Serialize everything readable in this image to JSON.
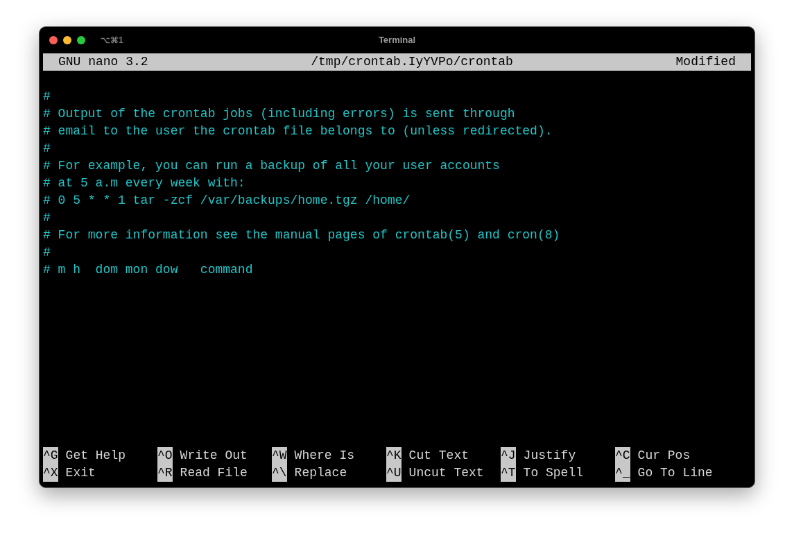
{
  "window": {
    "title": "Terminal",
    "shortcut": "⌥⌘1"
  },
  "header": {
    "app": "GNU nano 3.2",
    "file": "/tmp/crontab.IyYVPo/crontab",
    "status": "Modified"
  },
  "lines": [
    "#",
    "# Output of the crontab jobs (including errors) is sent through",
    "# email to the user the crontab file belongs to (unless redirected).",
    "#",
    "# For example, you can run a backup of all your user accounts",
    "# at 5 a.m every week with:",
    "# 0 5 * * 1 tar -zcf /var/backups/home.tgz /home/",
    "#",
    "# For more information see the manual pages of crontab(5) and cron(8)",
    "#",
    "# m h  dom mon dow   command"
  ],
  "shortcuts": [
    [
      {
        "key": "^G",
        "label": "Get Help"
      },
      {
        "key": "^O",
        "label": "Write Out"
      },
      {
        "key": "^W",
        "label": "Where Is"
      },
      {
        "key": "^K",
        "label": "Cut Text"
      },
      {
        "key": "^J",
        "label": "Justify"
      },
      {
        "key": "^C",
        "label": "Cur Pos"
      }
    ],
    [
      {
        "key": "^X",
        "label": "Exit"
      },
      {
        "key": "^R",
        "label": "Read File"
      },
      {
        "key": "^\\",
        "label": "Replace"
      },
      {
        "key": "^U",
        "label": "Uncut Text"
      },
      {
        "key": "^T",
        "label": "To Spell"
      },
      {
        "key": "^_",
        "label": "Go To Line"
      }
    ]
  ]
}
